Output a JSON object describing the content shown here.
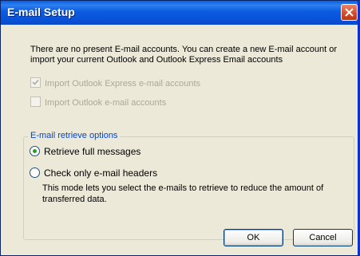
{
  "window": {
    "title": "E-mail Setup"
  },
  "intro_text": "There are no present E-mail accounts. You can create a new E-mail account or import your current Outlook and Outlook Express Email accounts",
  "imports": {
    "outlook_express": {
      "label": "Import Outlook Express e-mail accounts",
      "checked": true,
      "enabled": false
    },
    "outlook": {
      "label": "Import Outlook e-mail accounts",
      "checked": false,
      "enabled": false
    }
  },
  "retrieve_options": {
    "legend": "E-mail retrieve options",
    "full_messages": {
      "label": "Retrieve full messages",
      "selected": true
    },
    "headers_only": {
      "label": "Check only e-mail headers",
      "selected": false
    },
    "headers_description": "This mode lets you select the e-mails to retrieve to reduce the amount of transferred data."
  },
  "buttons": {
    "ok": "OK",
    "cancel": "Cancel"
  },
  "colors": {
    "titlebar": "#0a5be0",
    "dialog_bg": "#ece9d8",
    "group_legend": "#0046d5",
    "close_button": "#d04a28"
  }
}
